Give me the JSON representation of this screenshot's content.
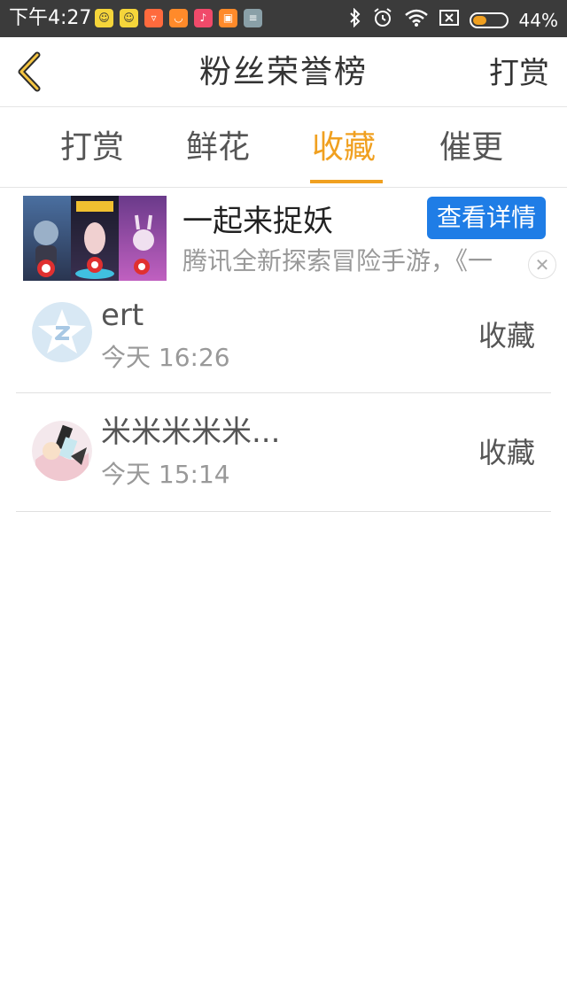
{
  "status_bar": {
    "time": "下午4:27",
    "battery_text": "44%",
    "battery_level": 0.44,
    "app_icons": [
      {
        "name": "qq-app-icon",
        "color": "#f5d53a"
      },
      {
        "name": "qq-app-icon",
        "color": "#f5d53a"
      },
      {
        "name": "taobao-app-icon",
        "color": "#ff6a3d"
      },
      {
        "name": "tmall-app-icon",
        "color": "#ff8a2a"
      },
      {
        "name": "music-app-icon",
        "color": "#f04a6a"
      },
      {
        "name": "mi-app-icon",
        "color": "#ff8a2a"
      },
      {
        "name": "notes-app-icon",
        "color": "#8aa0a8"
      }
    ],
    "icons": [
      "bluetooth-icon",
      "alarm-icon",
      "wifi-icon",
      "sim-icon",
      "battery-icon"
    ]
  },
  "header": {
    "title": "粉丝荣誉榜",
    "action_label": "打赏",
    "back_icon": "chevron-left-icon",
    "accent": "#f0a020"
  },
  "tabs": [
    {
      "label": "打赏",
      "active": false
    },
    {
      "label": "鲜花",
      "active": false
    },
    {
      "label": "收藏",
      "active": true
    },
    {
      "label": "催更",
      "active": false
    }
  ],
  "ad": {
    "title": "一起来捉妖",
    "button_label": "查看详情",
    "description": "腾讯全新探索冒险手游，《一",
    "close_icon": "close-icon",
    "button_color": "#1f7de6"
  },
  "list": [
    {
      "name": "ert",
      "time": "今天 16:26",
      "action": "收藏",
      "avatar": "default-star-avatar"
    },
    {
      "name": "米米米米米...",
      "time": "今天 15:14",
      "action": "收藏",
      "avatar": "anime-avatar"
    }
  ]
}
